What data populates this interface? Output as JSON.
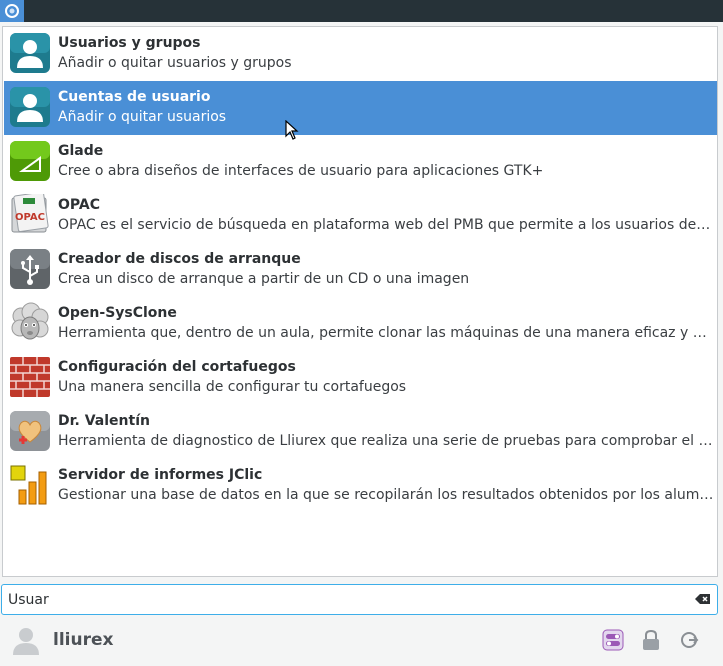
{
  "results": [
    {
      "title": "Usuarios y grupos",
      "description": "Añadir o quitar usuarios y grupos",
      "icon": "user-group-icon"
    },
    {
      "title": "Cuentas de usuario",
      "description": "Añadir o quitar usuarios",
      "icon": "user-accounts-icon",
      "selected": true
    },
    {
      "title": "Glade",
      "description": "Cree o abra diseños de interfaces de usuario para aplicaciones GTK+",
      "icon": "glade-icon"
    },
    {
      "title": "OPAC",
      "description": "OPAC es el servicio de búsqueda en plataforma web del PMB que permite a los usuarios de b...",
      "icon": "opac-icon",
      "icon_text": "OPAC"
    },
    {
      "title": "Creador de discos de arranque",
      "description": "Crea un disco de arranque a partir de un CD o una imagen",
      "icon": "usb-icon"
    },
    {
      "title": "Open-SysClone",
      "description": "Herramienta que, dentro de un aula, permite clonar las máquinas de una manera eficaz y pre...",
      "icon": "sheep-icon"
    },
    {
      "title": "Configuración del cortafuegos",
      "description": "Una manera sencilla de configurar tu cortafuegos",
      "icon": "firewall-icon"
    },
    {
      "title": "Dr. Valentín",
      "description": "Herramienta de diagnostico de Lliurex que realiza una serie de pruebas para comprobar el es...",
      "icon": "dr-valentin-icon"
    },
    {
      "title": "Servidor de informes JClic",
      "description": "Gestionar una base de datos en la que se recopilarán los resultados obtenidos por los alumn...",
      "icon": "jclic-reports-icon"
    }
  ],
  "search": {
    "value": "Usuar"
  },
  "footer": {
    "username": "lliurex"
  },
  "colors": {
    "selection": "#4a8fd6",
    "taskbar": "#263238",
    "focus": "#3daee9"
  }
}
